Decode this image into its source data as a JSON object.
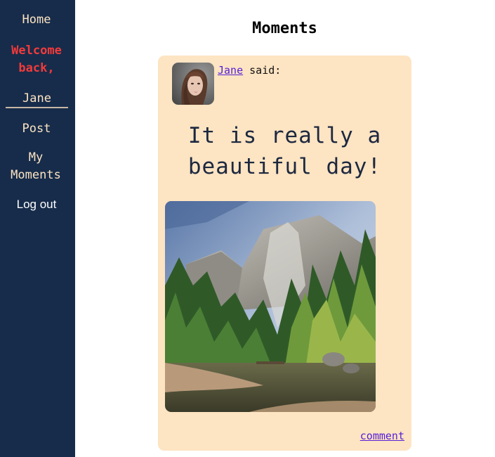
{
  "sidebar": {
    "home_label": "Home",
    "welcome_text": "Welcome back,",
    "username": "Jane",
    "post_label": "Post",
    "my_moments_label": "My Moments",
    "logout_label": "Log out"
  },
  "main": {
    "title": "Moments",
    "post": {
      "author": "Jane",
      "said_suffix": "said:",
      "text": "It is really a beautiful day!",
      "avatar_icon": "woman-portrait-avatar",
      "image_icon": "mountain-forest-landscape-photo",
      "comment_label": "comment"
    }
  },
  "colors": {
    "sidebar_bg": "#172c4b",
    "nav_text": "#fde4c2",
    "welcome_text": "#f33a3a",
    "card_bg": "#fde4c2",
    "link": "#5520d8"
  }
}
